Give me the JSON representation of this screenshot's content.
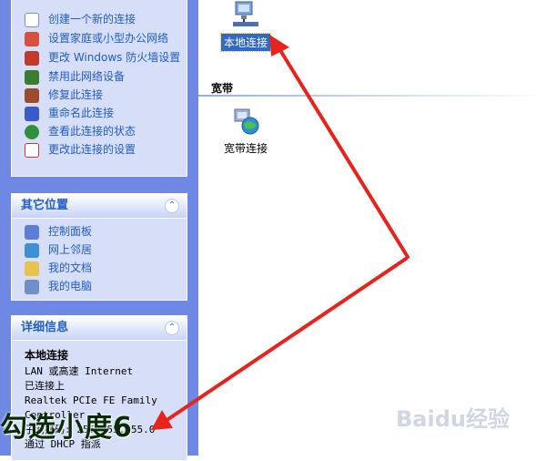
{
  "network_tasks": [
    {
      "label": "创建一个新的连接",
      "icon": "new-connection-icon"
    },
    {
      "label": "设置家庭或小型办公网络",
      "icon": "home-network-icon"
    },
    {
      "label": "更改 Windows 防火墙设置",
      "icon": "firewall-icon"
    },
    {
      "label": "禁用此网络设备",
      "icon": "disable-device-icon"
    },
    {
      "label": "修复此连接",
      "icon": "repair-icon"
    },
    {
      "label": "重命名此连接",
      "icon": "rename-icon"
    },
    {
      "label": "查看此连接的状态",
      "icon": "status-icon"
    },
    {
      "label": "更改此连接的设置",
      "icon": "settings-icon"
    }
  ],
  "other_places": {
    "title": "其它位置",
    "items": [
      {
        "label": "控制面板",
        "icon": "control-panel-icon"
      },
      {
        "label": "网上邻居",
        "icon": "network-places-icon"
      },
      {
        "label": "我的文档",
        "icon": "my-documents-icon"
      },
      {
        "label": "我的电脑",
        "icon": "my-computer-icon"
      }
    ]
  },
  "details": {
    "title": "详细信息",
    "name": "本地连接",
    "type": "LAN 或高速 Internet",
    "status": "已连接上",
    "adapter": "Realtek PCIe FE Family",
    "adapter2": "Controller",
    "subnet": "子网掩码: 255.255.255.0",
    "dhcp": "通过 DHCP 指派"
  },
  "main": {
    "local_connection": "本地连接",
    "broadband_header": "宽带",
    "broadband_connection": "宽带连接"
  },
  "overlay_text": "勾选小度6",
  "watermark": "Baidu经验",
  "colors": {
    "sidebar_bg": "#6f88e4",
    "panel_bg": "#d6dff7",
    "link": "#215dc6",
    "selection": "#316ac5",
    "arrow": "#e8231c"
  }
}
